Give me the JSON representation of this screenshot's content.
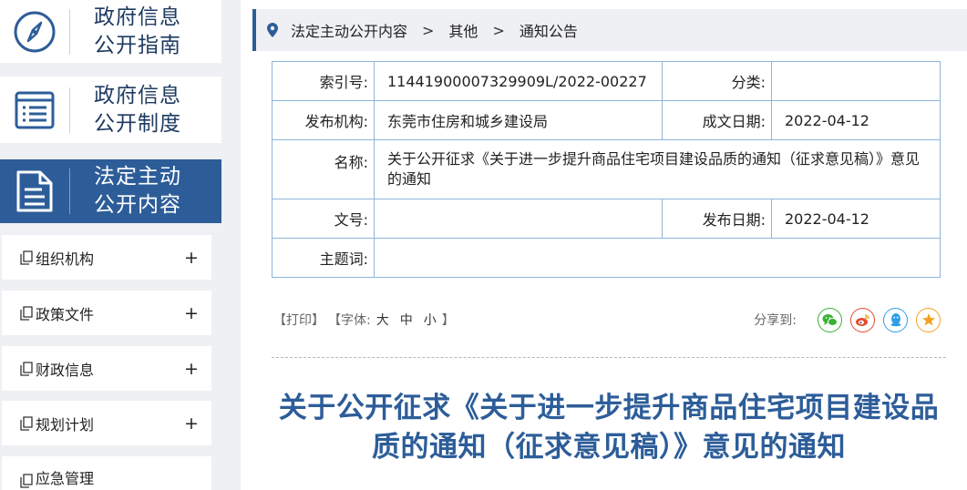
{
  "sidebar": {
    "cards": [
      {
        "line1": "政府信息",
        "line2": "公开指南",
        "icon": "compass-icon"
      },
      {
        "line1": "政府信息",
        "line2": "公开制度",
        "icon": "list-document-icon"
      },
      {
        "line1": "法定主动",
        "line2": "公开内容",
        "icon": "document-icon"
      }
    ],
    "menu": [
      {
        "label": "组织机构",
        "toggle": "+"
      },
      {
        "label": "政策文件",
        "toggle": "+"
      },
      {
        "label": "财政信息",
        "toggle": "+"
      },
      {
        "label": "规划计划",
        "toggle": "+"
      },
      {
        "label": "应急管理",
        "toggle": ""
      }
    ]
  },
  "breadcrumb": {
    "items": [
      "法定主动公开内容",
      "其他",
      "通知公告"
    ],
    "separator": ">"
  },
  "meta": {
    "index_label": "索引号:",
    "index_value": "11441900007329909L/2022-00227",
    "category_label": "分类:",
    "category_value": "",
    "publisher_label": "发布机构:",
    "publisher_value": "东莞市住房和城乡建设局",
    "created_label": "成文日期:",
    "created_value": "2022-04-12",
    "name_label": "名称:",
    "name_value": "关于公开征求《关于进一步提升商品住宅项目建设品质的通知（征求意见稿）》意见的通知",
    "doc_no_label": "文号:",
    "doc_no_value": "",
    "published_label": "发布日期:",
    "published_value": "2022-04-12",
    "keywords_label": "主题词:",
    "keywords_value": ""
  },
  "tools": {
    "print": "【打印】",
    "font_prefix": "【字体:",
    "font_large": "大",
    "font_medium": "中",
    "font_small": "小",
    "font_suffix": "】",
    "share_label": "分享到:",
    "share": [
      {
        "icon": "wechat-icon",
        "color": "#3cb035"
      },
      {
        "icon": "weibo-icon",
        "color": "#e6492d"
      },
      {
        "icon": "qq-icon",
        "color": "#2e9fe6"
      },
      {
        "icon": "qzone-icon",
        "color": "#f2a11f"
      }
    ]
  },
  "article": {
    "title": "关于公开征求《关于进一步提升商品住宅项目建设品质的通知（征求意见稿）》意见的通知"
  },
  "colors": {
    "brand": "#2d5d99",
    "border": "#8fb5dc",
    "panel": "#eef0f3"
  }
}
